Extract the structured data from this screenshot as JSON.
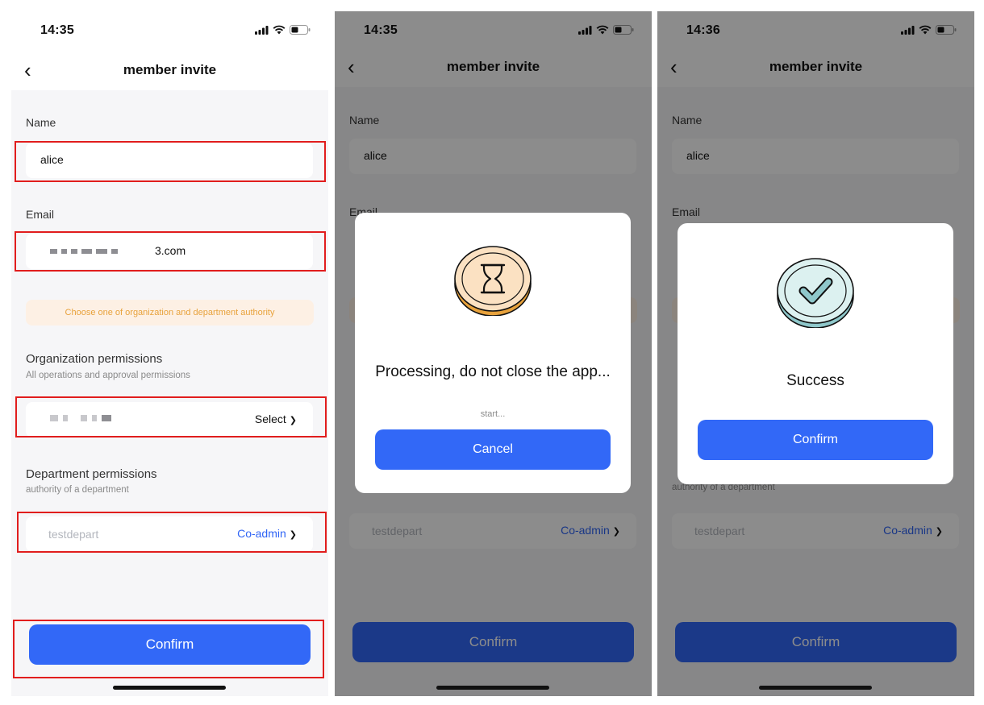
{
  "screens": [
    {
      "status": {
        "time": "14:35"
      },
      "nav": {
        "title": "member invite"
      },
      "form": {
        "name_label": "Name",
        "name_value": "alice",
        "email_label": "Email",
        "email_value_suffix": "3.com",
        "notice": "Choose one of organization and department authority",
        "org_label": "Organization permissions",
        "org_sub": "All operations and approval permissions",
        "org_select": "Select",
        "dept_label": "Department permissions",
        "dept_sub": "authority of a department",
        "dept_placeholder": "testdepart",
        "dept_select": "Co-admin"
      },
      "confirm_label": "Confirm",
      "highlighted": [
        "name-field",
        "email-field",
        "org-field",
        "dept-field",
        "confirm-button"
      ]
    },
    {
      "status": {
        "time": "14:35"
      },
      "nav": {
        "title": "member invite"
      },
      "form": {
        "name_label": "Name",
        "name_value": "alice",
        "email_label": "Email",
        "dept_placeholder": "testdepart",
        "dept_select": "Co-admin"
      },
      "confirm_label": "Confirm",
      "dialog": {
        "icon": "hourglass-icon",
        "title": "Processing, do not close the app...",
        "subtitle": "start...",
        "button": "Cancel"
      }
    },
    {
      "status": {
        "time": "14:36"
      },
      "nav": {
        "title": "member invite"
      },
      "form": {
        "name_label": "Name",
        "name_value": "alice",
        "email_label": "Email",
        "dept_sub": "authority of a department",
        "dept_placeholder": "testdepart",
        "dept_select": "Co-admin"
      },
      "confirm_label": "Confirm",
      "dialog": {
        "icon": "checkmark-icon",
        "title": "Success",
        "button": "Confirm"
      }
    }
  ],
  "colors": {
    "primary": "#3268f7",
    "highlight": "#e11d1d",
    "notice_text": "#e8a23c",
    "notice_bg": "#fdf0e4",
    "hourglass_fill": "#fbe1c2",
    "hourglass_edge": "#e8a23c",
    "success_fill": "#dcf1f0",
    "success_edge": "#8fc8cb"
  }
}
